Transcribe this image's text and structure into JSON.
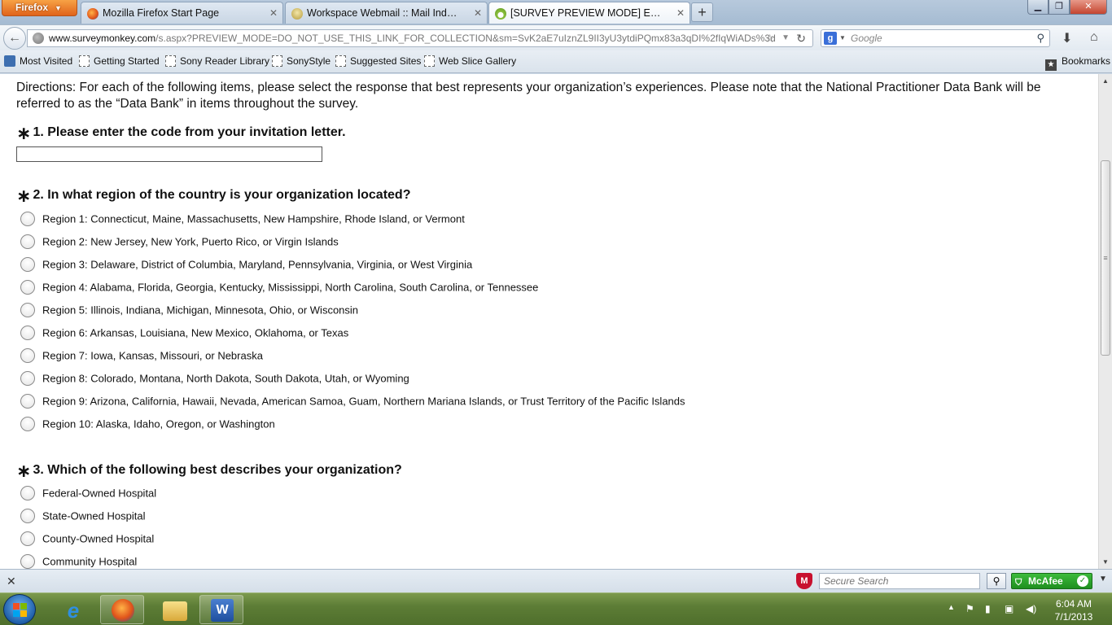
{
  "browser": {
    "menu_label": "Firefox",
    "tabs": [
      {
        "label": "Mozilla Firefox Start Page",
        "active": false
      },
      {
        "label": "Workspace Webmail :: Mail Index :: Se...",
        "active": false
      },
      {
        "label": "[SURVEY PREVIEW MODE] Entity Surv...",
        "active": true
      }
    ],
    "url_domain": "www.surveymonkey.com",
    "url_path": "/s.aspx?PREVIEW_MODE=DO_NOT_USE_THIS_LINK_FOR_COLLECTION&sm=SvK2aE7uIznZL9II3yU3ytdiPQmx83a3qDI%2fIqWiADs%3d",
    "search_placeholder": "Google",
    "bookmarks": [
      {
        "label": "Most Visited",
        "icon": "most-visited-icon"
      },
      {
        "label": "Getting Started",
        "icon": "bookmark-folder-icon"
      },
      {
        "label": "Sony Reader Library",
        "icon": "bookmark-folder-icon"
      },
      {
        "label": "SonyStyle",
        "icon": "bookmark-folder-icon"
      },
      {
        "label": "Suggested Sites",
        "icon": "bookmark-folder-icon"
      },
      {
        "label": "Web Slice Gallery",
        "icon": "bookmark-folder-icon"
      }
    ],
    "bookmarks_menu_label": "Bookmarks"
  },
  "survey": {
    "directions": "Directions: For each of the following items, please select the response that best represents your organization’s experiences. Please note that the National Practitioner Data Bank will be referred to as the “Data Bank” in items throughout the survey.",
    "required_mark": "∗",
    "q1": {
      "title": "1. Please enter the code from your invitation letter.",
      "value": ""
    },
    "q2": {
      "title": "2. In what region of the country is your organization located?",
      "options": [
        "Region 1: Connecticut, Maine, Massachusetts, New Hampshire, Rhode Island, or Vermont",
        "Region 2: New Jersey, New York, Puerto Rico, or Virgin Islands",
        "Region 3: Delaware, District of Columbia, Maryland, Pennsylvania, Virginia, or West Virginia",
        "Region 4: Alabama, Florida, Georgia, Kentucky, Mississippi, North Carolina, South Carolina, or Tennessee",
        "Region 5: Illinois, Indiana, Michigan, Minnesota, Ohio, or Wisconsin",
        "Region 6: Arkansas, Louisiana, New Mexico, Oklahoma, or Texas",
        "Region 7: Iowa, Kansas, Missouri, or Nebraska",
        "Region 8: Colorado, Montana, North Dakota, South Dakota, Utah, or Wyoming",
        "Region 9: Arizona, California, Hawaii, Nevada, American Samoa, Guam, Northern Mariana Islands, or Trust Territory of the Pacific Islands",
        "Region 10: Alaska, Idaho, Oregon, or Washington"
      ]
    },
    "q3": {
      "title": "3. Which of the following best describes your organization?",
      "options": [
        "Federal-Owned Hospital",
        "State-Owned Hospital",
        "County-Owned Hospital",
        "Community Hospital"
      ]
    }
  },
  "addon_bar": {
    "secure_search_placeholder": "Secure Search",
    "mcafee_label": "McAfee"
  },
  "taskbar": {
    "time": "6:04 AM",
    "date": "7/1/2013"
  },
  "colors": {
    "accent_orange": "#e0631a",
    "mcafee_green": "#1f8f1f",
    "mcafee_red": "#c8102e"
  }
}
